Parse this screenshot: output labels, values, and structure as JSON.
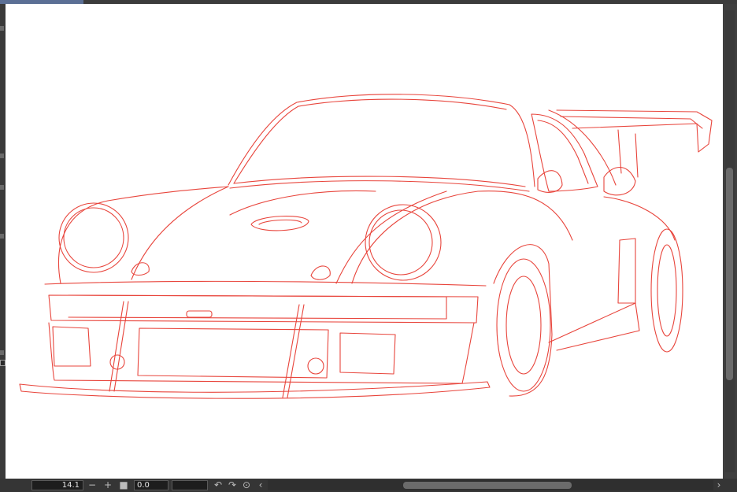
{
  "window": {
    "active_tab_color": "#5b6f95",
    "canvas_background": "#ffffff",
    "line_color": "#e8453c"
  },
  "canvas": {
    "subject": "red line art sketch of a wide-body sports car with rear wing"
  },
  "statusbar": {
    "zoom_value": "14.1",
    "zoom_out_icon": "minus-icon",
    "zoom_in_icon": "plus-icon",
    "fit_icon": "square-icon",
    "angle_value": "0.0",
    "rotate_left_icon": "rotate-left-icon",
    "rotate_right_icon": "rotate-right-icon",
    "reset_rotation_icon": "reset-rotation-icon",
    "scroll_left_icon": "chevron-left-icon",
    "scroll_right_icon": "chevron-right-icon"
  }
}
